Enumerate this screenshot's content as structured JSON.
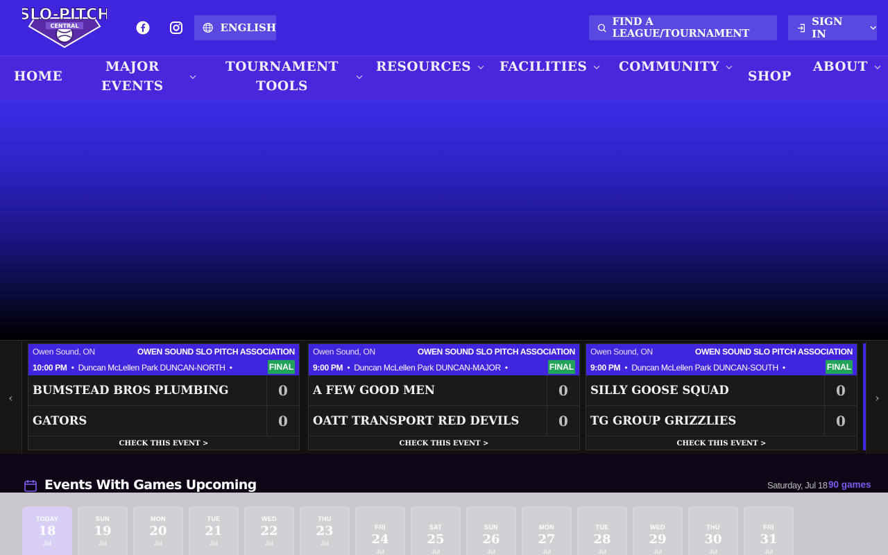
{
  "header": {
    "logo_text_top": "SLO-PITCH",
    "logo_text_bottom": "CENTRAL",
    "language_label": "ENGLISH",
    "find_label": "FIND A LEAGUE/TOURNAMENT",
    "signin_label": "SIGN IN"
  },
  "nav": {
    "items": [
      {
        "label": "HOME",
        "dropdown": false
      },
      {
        "label": "MAJOR EVENTS",
        "line1": "MAJOR",
        "line2": "EVENTS",
        "dropdown": true
      },
      {
        "label": "TOURNAMENT TOOLS",
        "line1": "TOURNAMENT",
        "line2": "TOOLS",
        "dropdown": true
      },
      {
        "label": "RESOURCES",
        "dropdown": true
      },
      {
        "label": "FACILITIES",
        "dropdown": true
      },
      {
        "label": "COMMUNITY",
        "dropdown": true
      },
      {
        "label": "SHOP",
        "dropdown": false
      },
      {
        "label": "ABOUT",
        "dropdown": true
      }
    ]
  },
  "scores": {
    "check_label": "CHECK THIS EVENT >",
    "games": [
      {
        "city": "Owen Sound, ON",
        "org": "OWEN SOUND SLO PITCH ASSOCIATION",
        "time": "10:00 PM",
        "venue": "Duncan McLellen Park DUNCAN-NORTH",
        "status": "FINAL",
        "teams": [
          {
            "name": "BUMSTEAD BROS PLUMBING",
            "score": "0"
          },
          {
            "name": "GATORS",
            "score": "0"
          }
        ]
      },
      {
        "city": "Owen Sound, ON",
        "org": "OWEN SOUND SLO PITCH ASSOCIATION",
        "time": "9:00 PM",
        "venue": "Duncan McLellen Park DUNCAN-MAJOR",
        "status": "FINAL",
        "teams": [
          {
            "name": "A FEW GOOD MEN",
            "score": "0"
          },
          {
            "name": "OATT TRANSPORT RED DEVILS",
            "score": "0"
          }
        ]
      },
      {
        "city": "Owen Sound, ON",
        "org": "OWEN SOUND SLO PITCH ASSOCIATION",
        "time": "9:00 PM",
        "venue": "Duncan McLellen Park DUNCAN-SOUTH",
        "status": "FINAL",
        "teams": [
          {
            "name": "SILLY GOOSE SQUAD",
            "score": "0"
          },
          {
            "name": "TG GROUP GRIZZLIES",
            "score": "0"
          }
        ]
      }
    ]
  },
  "events": {
    "title": "Events With Games Upcoming",
    "date": "Saturday, Jul 18",
    "count": "90 games",
    "days": [
      {
        "dow": "TODAY",
        "num": "18",
        "mon": "Jul"
      },
      {
        "dow": "SUN",
        "num": "19",
        "mon": "Jul"
      },
      {
        "dow": "MON",
        "num": "20",
        "mon": "Jul"
      },
      {
        "dow": "TUE",
        "num": "21",
        "mon": "Jul"
      },
      {
        "dow": "WED",
        "num": "22",
        "mon": "Jul"
      },
      {
        "dow": "THU",
        "num": "23",
        "mon": "Jul"
      },
      {
        "dow": "FRI",
        "num": "24",
        "mon": "Jul"
      },
      {
        "dow": "SAT",
        "num": "25",
        "mon": "Jul"
      },
      {
        "dow": "SUN",
        "num": "26",
        "mon": "Jul"
      },
      {
        "dow": "MON",
        "num": "27",
        "mon": "Jul"
      },
      {
        "dow": "TUE",
        "num": "28",
        "mon": "Jul"
      },
      {
        "dow": "WED",
        "num": "29",
        "mon": "Jul"
      },
      {
        "dow": "THU",
        "num": "30",
        "mon": "Jul"
      },
      {
        "dow": "FRI",
        "num": "31",
        "mon": "Jul"
      }
    ]
  },
  "colors": {
    "brand": "#3f25dd",
    "nav": "#4a27dc",
    "final": "#21a35a",
    "accent": "#7b5cf0"
  }
}
